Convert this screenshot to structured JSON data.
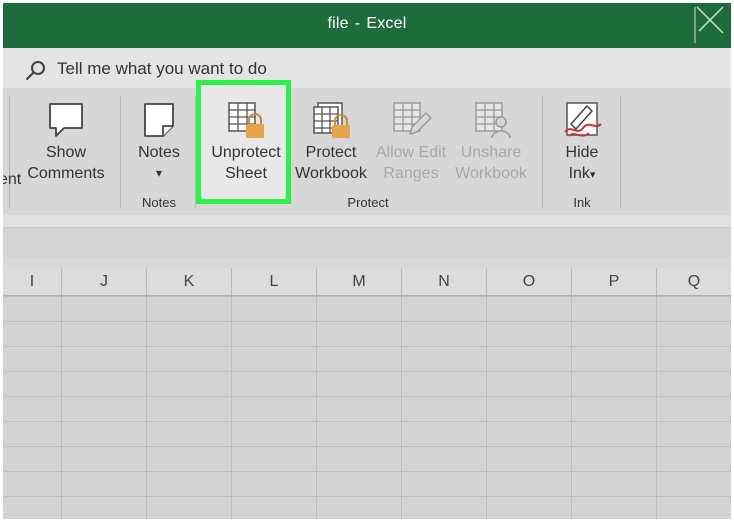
{
  "window": {
    "file": "file",
    "separator": "-",
    "app": "Excel"
  },
  "tell_me": {
    "text": "Tell me what you want to do"
  },
  "ribbon": {
    "partial_left_label": "ent",
    "show_comments": {
      "line1": "Show",
      "line2": "Comments"
    },
    "notes": {
      "label": "Notes",
      "dropdown": "▾"
    },
    "groups": {
      "notes": "Notes",
      "protect": "Protect",
      "ink": "Ink"
    },
    "unprotect_sheet": {
      "line1": "Unprotect",
      "line2": "Sheet"
    },
    "protect_workbook": {
      "line1": "Protect",
      "line2": "Workbook"
    },
    "allow_edit_ranges": {
      "line1": "Allow Edit",
      "line2": "Ranges"
    },
    "unshare_workbook": {
      "line1": "Unshare",
      "line2": "Workbook"
    },
    "hide_ink": {
      "line1": "Hide",
      "line2": "Ink"
    }
  },
  "columns": [
    "I",
    "J",
    "K",
    "L",
    "M",
    "N",
    "O",
    "P",
    "Q"
  ],
  "colors": {
    "title_bar": "#1e6b3c",
    "highlight": "#2ef04a",
    "lock": "#e8a24a"
  }
}
